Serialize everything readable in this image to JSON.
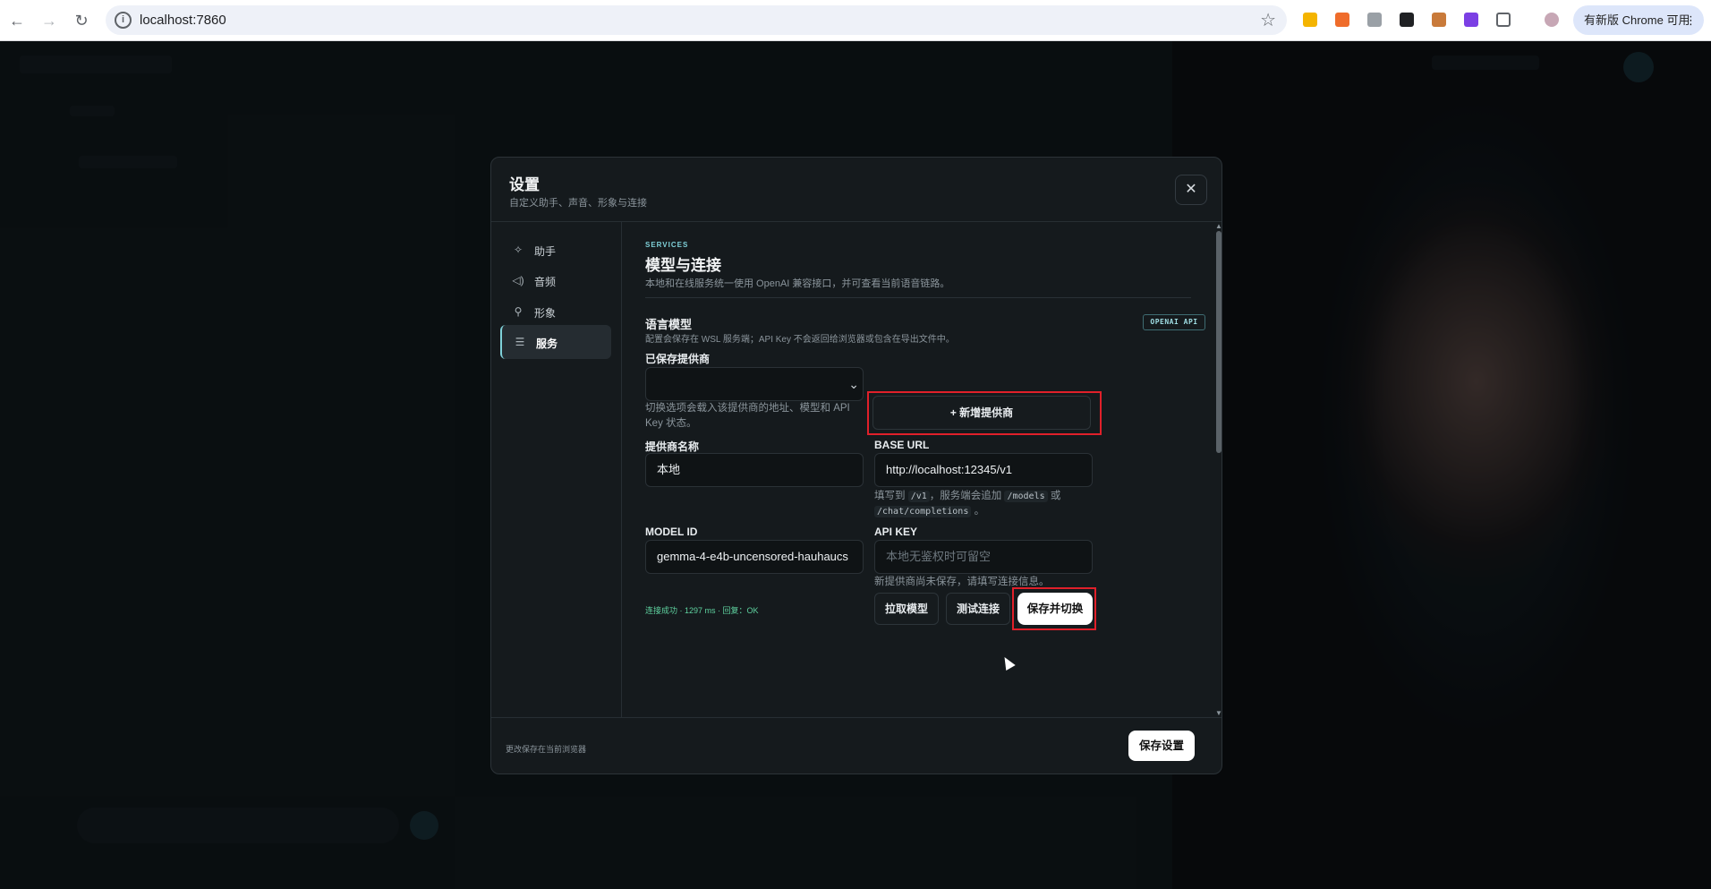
{
  "browser": {
    "url": "localhost:7860",
    "update_label": "有新版 Chrome 可用"
  },
  "modal": {
    "title": "设置",
    "subtitle": "自定义助手、声音、形象与连接",
    "close_label": "✕",
    "sidebar": [
      {
        "label": "助手",
        "icon": "sparkle-icon"
      },
      {
        "label": "音频",
        "icon": "speaker-icon"
      },
      {
        "label": "形象",
        "icon": "person-icon"
      },
      {
        "label": "服务",
        "icon": "server-icon"
      }
    ],
    "footer_note": "更改保存在当前浏览器",
    "save_settings_label": "保存设置"
  },
  "services": {
    "eyebrow": "SERVICES",
    "title": "模型与连接",
    "description": "本地和在线服务统一使用 OpenAI 兼容接口，并可查看当前语音链路。",
    "llm_title": "语言模型",
    "badge": "OPENAI API",
    "llm_desc": "配置会保存在 WSL 服务端；API Key 不会返回给浏览器或包含在导出文件中。",
    "saved_provider_label": "已保存提供商",
    "saved_provider_value": "",
    "saved_provider_hint": "切换选项会载入该提供商的地址、模型和 API Key 状态。",
    "add_provider_label": "+ 新增提供商",
    "provider_name_label": "提供商名称",
    "provider_name_value": "本地",
    "base_url_label": "BASE URL",
    "base_url_value": "http://localhost:12345/v1",
    "base_url_hint_1": "填写到",
    "base_url_hint_code1": "/v1",
    "base_url_hint_2": "，服务端会追加",
    "base_url_hint_code2": "/models",
    "base_url_hint_3": "或",
    "base_url_hint_code3": "/chat/completions",
    "base_url_hint_4": "。",
    "model_id_label": "MODEL ID",
    "model_id_value": "gemma-4-e4b-uncensored-hauhaucs",
    "api_key_label": "API KEY",
    "api_key_placeholder": "本地无鉴权时可留空",
    "api_key_hint": "新提供商尚未保存，请填写连接信息。",
    "status": "连接成功 · 1297 ms · 回复：OK",
    "fetch_models_label": "拉取模型",
    "test_connection_label": "测试连接",
    "save_switch_label": "保存并切换"
  }
}
